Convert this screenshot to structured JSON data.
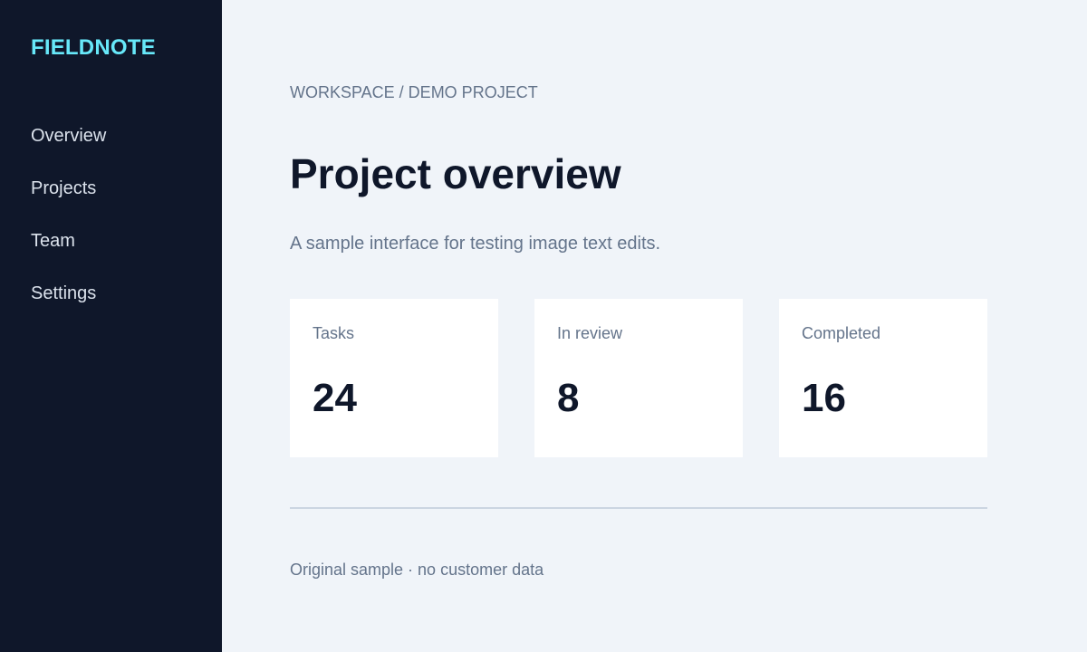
{
  "sidebar": {
    "brand": "FIELDNOTE",
    "items": [
      {
        "label": "Overview"
      },
      {
        "label": "Projects"
      },
      {
        "label": "Team"
      },
      {
        "label": "Settings"
      }
    ]
  },
  "main": {
    "breadcrumb": "WORKSPACE / DEMO PROJECT",
    "title": "Project overview",
    "subtitle": "A sample interface for testing image text edits.",
    "cards": [
      {
        "label": "Tasks",
        "value": "24"
      },
      {
        "label": "In review",
        "value": "8"
      },
      {
        "label": "Completed",
        "value": "16"
      }
    ],
    "footnote": "Original sample · no customer data"
  },
  "colors": {
    "sidebar_bg": "#0f172a",
    "brand": "#67e8f9",
    "page_bg": "#f0f4f9",
    "card_bg": "#ffffff",
    "text_primary": "#0f172a",
    "text_muted": "#64748b"
  }
}
